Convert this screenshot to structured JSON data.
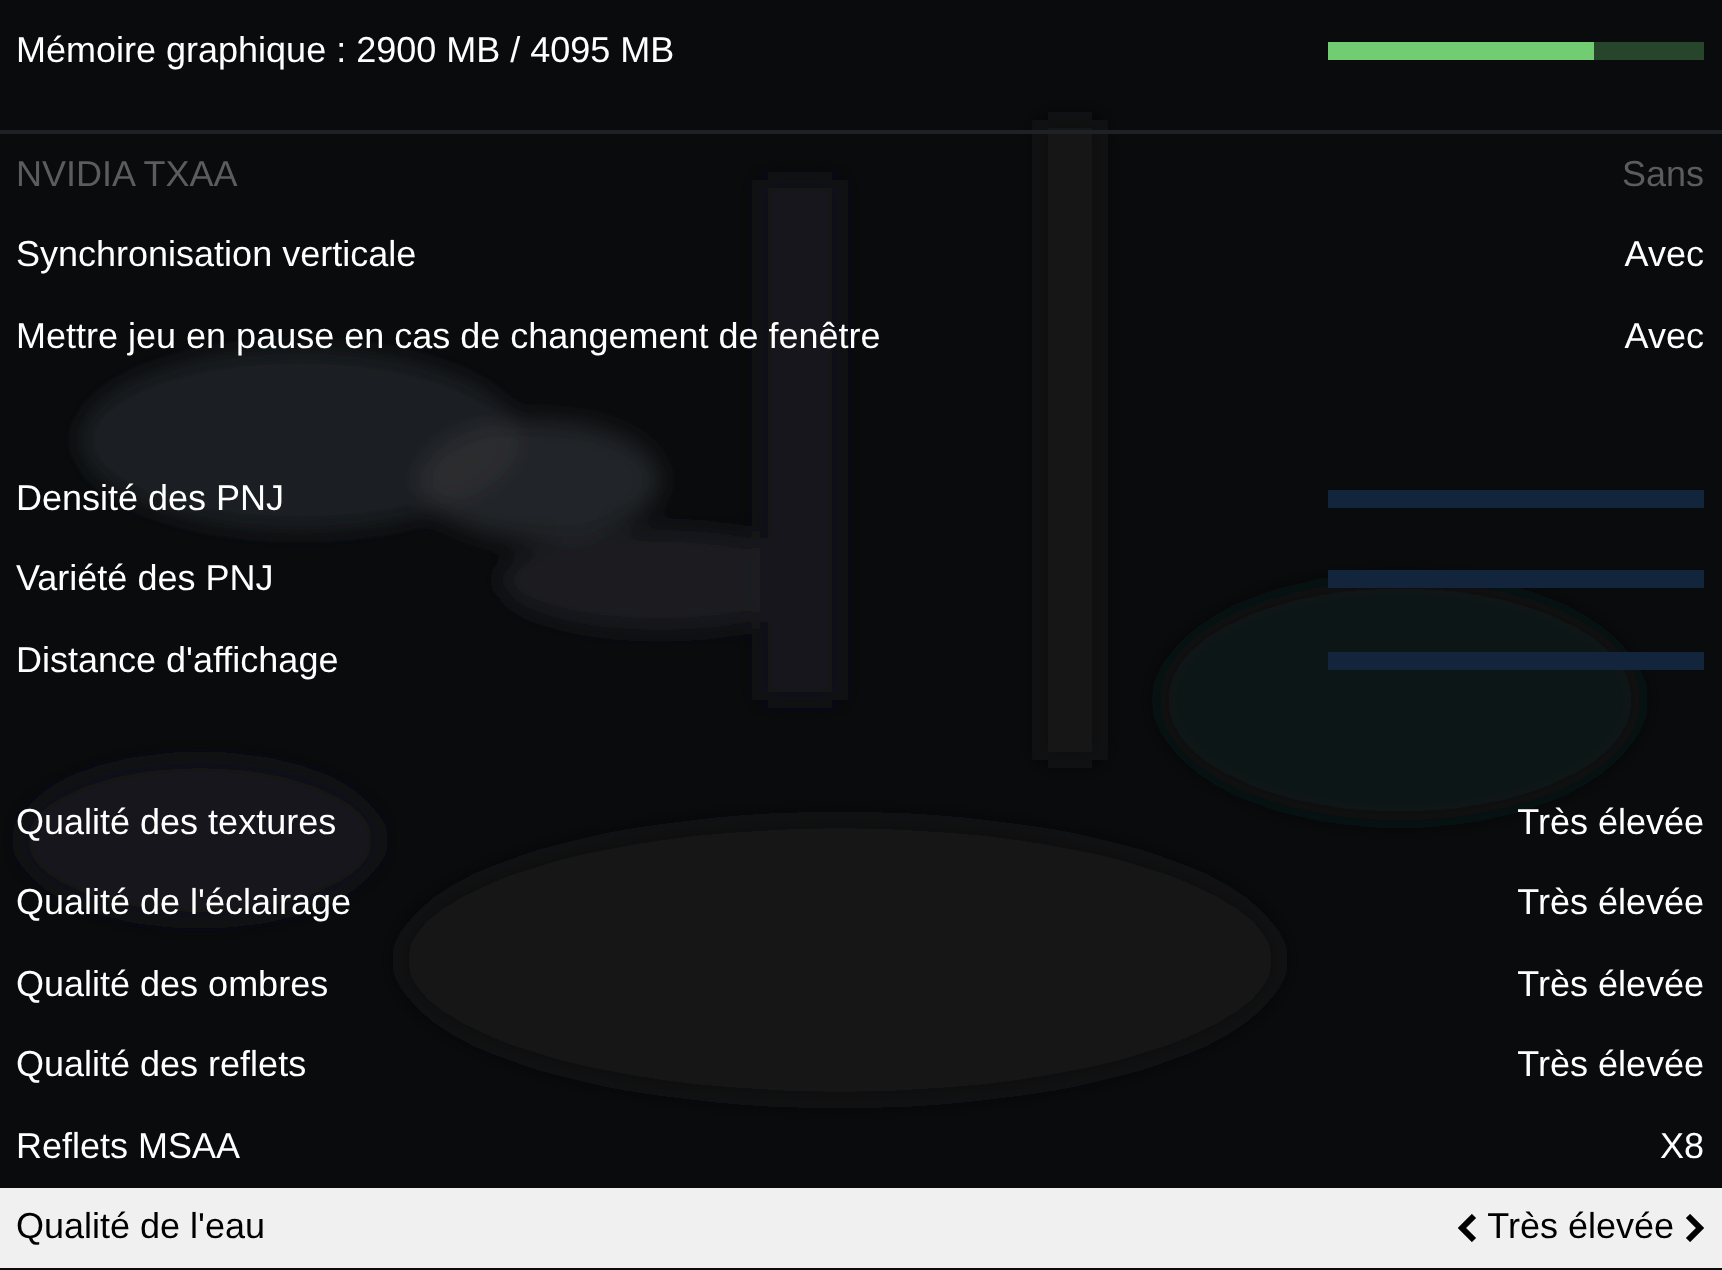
{
  "memory": {
    "label": "Mémoire graphique : 2900 MB / 4095 MB",
    "level": 0.708
  },
  "sections": [
    {
      "rows": [
        {
          "kind": "option",
          "label": "NVIDIA TXAA",
          "value": "Sans",
          "disabled": true,
          "selected": false
        },
        {
          "kind": "option",
          "label": "Synchronisation verticale",
          "value": "Avec",
          "disabled": false,
          "selected": false
        },
        {
          "kind": "option",
          "label": "Mettre jeu en pause en cas de changement de fenêtre",
          "value": "Avec",
          "disabled": false,
          "selected": false
        }
      ]
    },
    {
      "rows": [
        {
          "kind": "slider",
          "label": "Densité des PNJ",
          "disabled": false,
          "selected": false
        },
        {
          "kind": "slider",
          "label": "Variété des PNJ",
          "disabled": false,
          "selected": false
        },
        {
          "kind": "slider",
          "label": "Distance d'affichage",
          "disabled": false,
          "selected": false
        }
      ]
    },
    {
      "rows": [
        {
          "kind": "option",
          "label": "Qualité des textures",
          "value": "Très élevée",
          "disabled": false,
          "selected": false
        },
        {
          "kind": "option",
          "label": "Qualité de l'éclairage",
          "value": "Très élevée",
          "disabled": false,
          "selected": false
        },
        {
          "kind": "option",
          "label": "Qualité des ombres",
          "value": "Très élevée",
          "disabled": false,
          "selected": false
        },
        {
          "kind": "option",
          "label": "Qualité des reflets",
          "value": "Très élevée",
          "disabled": false,
          "selected": false
        },
        {
          "kind": "option",
          "label": "Reflets MSAA",
          "value": "X8",
          "disabled": false,
          "selected": false
        },
        {
          "kind": "option",
          "label": "Qualité de l'eau",
          "value": "Très élevée",
          "disabled": false,
          "selected": true
        }
      ]
    }
  ]
}
